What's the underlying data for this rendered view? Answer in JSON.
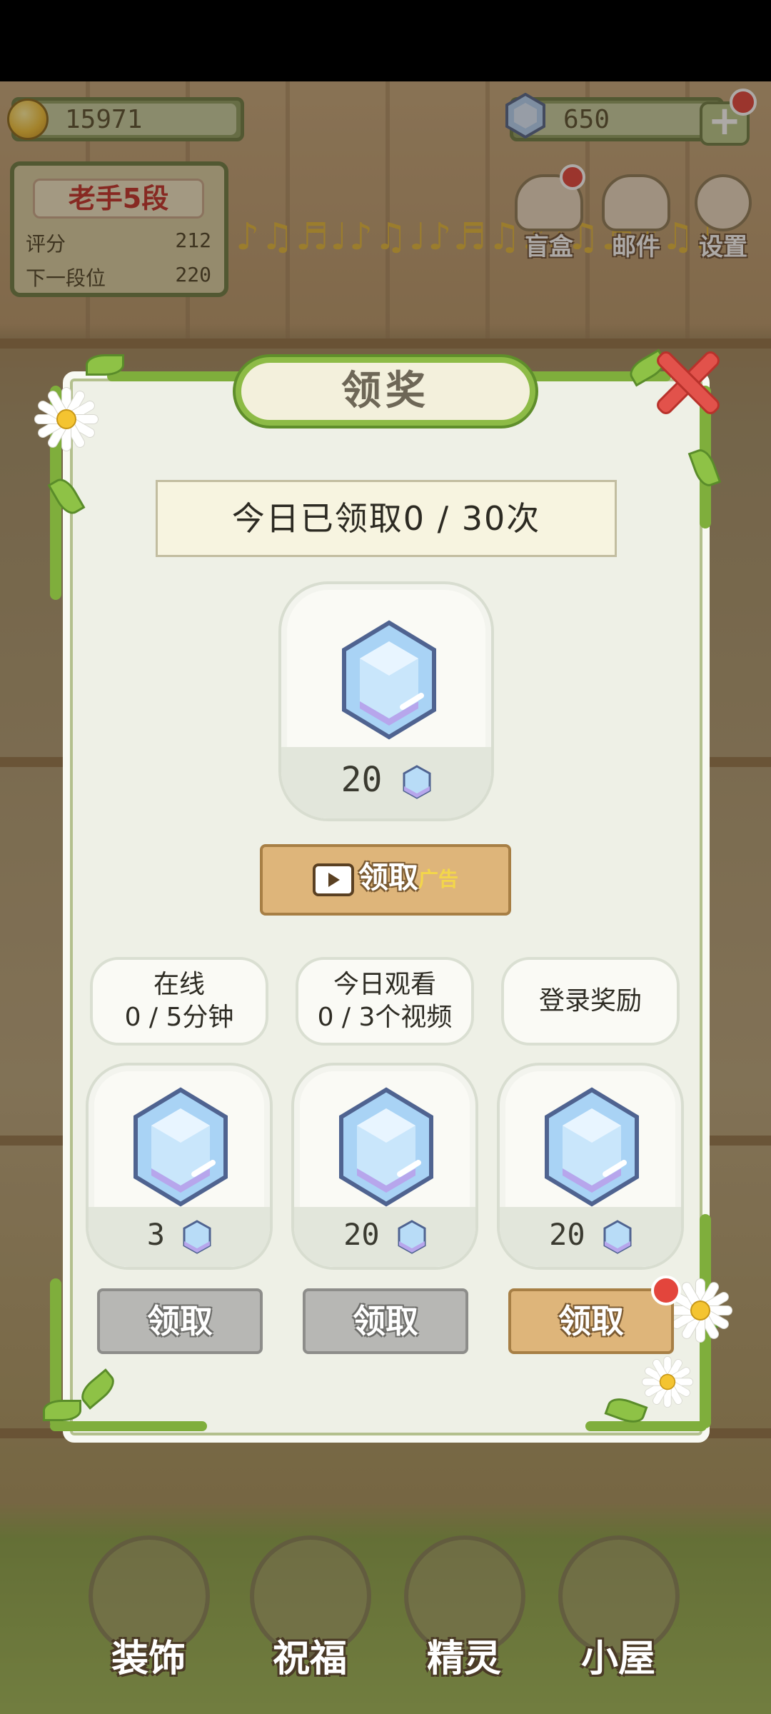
{
  "hud": {
    "coins": "15971",
    "gems": "650",
    "plus": "+",
    "rank": {
      "title": "老手5段",
      "score_label": "评分",
      "score_value": "212",
      "next_label": "下一段位",
      "next_value": "220"
    },
    "buttons": [
      {
        "label": "盲盒"
      },
      {
        "label": "邮件"
      },
      {
        "label": "设置"
      }
    ],
    "notes": "♪♫♬♩♪♫♩♪♬♫♪♩♫♬♪♫♩"
  },
  "modal": {
    "title": "领奖",
    "count_text": "今日已领取0 / 30次",
    "main_reward": {
      "amount": "20"
    },
    "ad_button": {
      "label": "领取",
      "tag": "广告"
    },
    "tasks": [
      {
        "line1": "在线",
        "line2": "0 / 5分钟",
        "amount": "3",
        "button": "领取",
        "state": "disabled"
      },
      {
        "line1": "今日观看",
        "line2": "0 / 3个视频",
        "amount": "20",
        "button": "领取",
        "state": "disabled"
      },
      {
        "line1": "登录奖励",
        "line2": "",
        "amount": "20",
        "button": "领取",
        "state": "active"
      }
    ]
  },
  "nav": [
    {
      "label": "装饰"
    },
    {
      "label": "祝福"
    },
    {
      "label": "精灵"
    },
    {
      "label": "小屋"
    }
  ],
  "colors": {
    "accent_green": "#8dbb46",
    "close_red": "#e2524b",
    "wood_button": "#deb57a",
    "disabled_button": "#b7b7b4"
  }
}
